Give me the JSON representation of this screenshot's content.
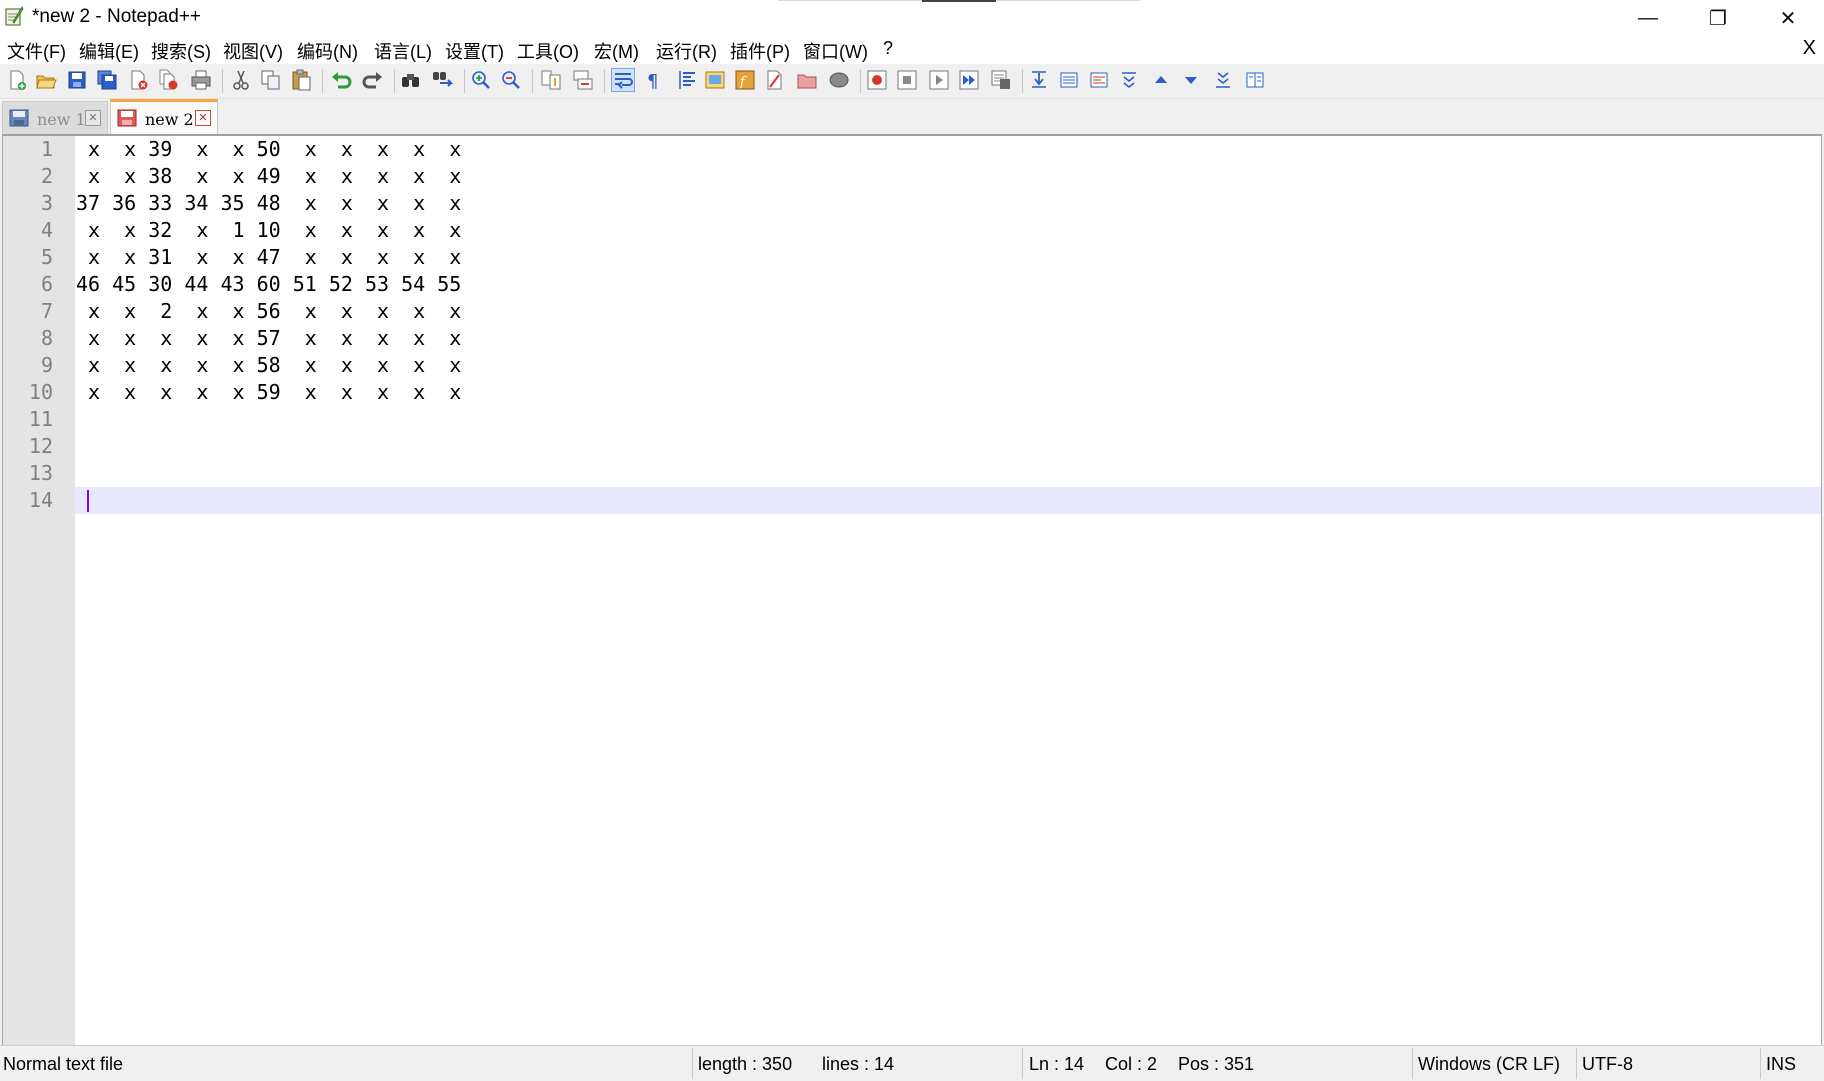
{
  "window": {
    "title": "*new 2 - Notepad++",
    "minimize_glyph": "—",
    "restore_glyph": "❐",
    "close_glyph": "✕"
  },
  "menu": {
    "items": [
      "文件(F)",
      "编辑(E)",
      "搜索(S)",
      "视图(V)",
      "编码(N)",
      "语言(L)",
      "设置(T)",
      "工具(O)",
      "宏(M)",
      "运行(R)",
      "插件(P)",
      "窗口(W)",
      "?"
    ],
    "close_doc": "X"
  },
  "toolbar": {
    "icons": [
      "new-file-icon",
      "open-file-icon",
      "save-icon",
      "save-all-icon",
      "close-icon",
      "close-all-icon",
      "print-icon",
      "cut-icon",
      "copy-icon",
      "paste-icon",
      "undo-icon",
      "redo-icon",
      "find-icon",
      "replace-icon",
      "zoom-in-icon",
      "zoom-out-icon",
      "sync-vertical-icon",
      "sync-horizontal-icon",
      "word-wrap-icon",
      "show-all-chars-icon",
      "indent-guide-icon",
      "doc-map-icon",
      "function-list-icon",
      "folder-as-workspace-icon",
      "monitoring-icon",
      "record-macro-icon",
      "stop-record-icon",
      "play-macro-icon",
      "run-macro-multiple-icon",
      "save-macro-icon"
    ],
    "colors": {
      "blue": "#2a5fc9",
      "green": "#2e9a3e",
      "red": "#d33a2a",
      "orange": "#e7a32e"
    }
  },
  "tabs": [
    {
      "label": "new  1",
      "active": false
    },
    {
      "label": "new  2",
      "active": true
    }
  ],
  "tab_close_glyph": "✕",
  "editor": {
    "line_numbers": [
      "1",
      "2",
      "3",
      "4",
      "5",
      "6",
      "7",
      "8",
      "9",
      "10",
      "11",
      "12",
      "13",
      "14"
    ],
    "lines": [
      " x  x 39  x  x 50  x  x  x  x  x",
      " x  x 38  x  x 49  x  x  x  x  x",
      "37 36 33 34 35 48  x  x  x  x  x",
      " x  x 32  x  1 10  x  x  x  x  x",
      " x  x 31  x  x 47  x  x  x  x  x",
      "46 45 30 44 43 60 51 52 53 54 55",
      " x  x  2  x  x 56  x  x  x  x  x",
      " x  x  x  x  x 57  x  x  x  x  x",
      " x  x  x  x  x 58  x  x  x  x  x",
      " x  x  x  x  x 59  x  x  x  x  x",
      "",
      "",
      "",
      ""
    ],
    "current_line_color": "#e8e8ff",
    "caret_color": "#8000ff"
  },
  "status": {
    "file_type": "Normal text file",
    "length": "length : 350",
    "lines": "lines : 14",
    "ln": "Ln : 14",
    "col": "Col : 2",
    "pos": "Pos : 351",
    "eol": "Windows (CR LF)",
    "encoding": "UTF-8",
    "mode": "INS"
  }
}
